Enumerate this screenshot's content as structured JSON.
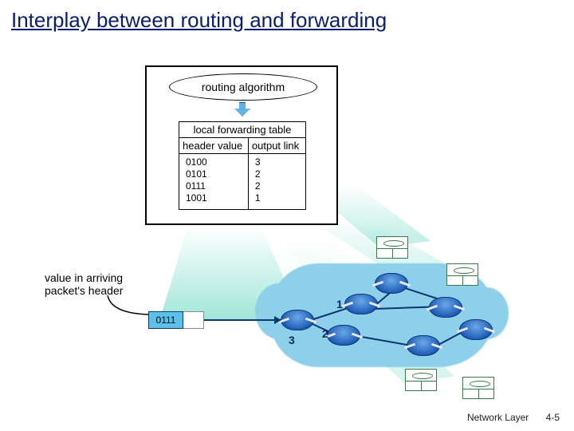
{
  "title": "Interplay between routing and forwarding",
  "routing_box": {
    "algorithm_label": "routing algorithm",
    "table_title": "local forwarding table",
    "col1": "header value",
    "col2": "output link",
    "rows": [
      {
        "header": "0100",
        "out": "3"
      },
      {
        "header": "0101",
        "out": "2"
      },
      {
        "header": "0111",
        "out": "2"
      },
      {
        "header": "1001",
        "out": "1"
      }
    ]
  },
  "annotation": "value in arriving packet's header",
  "packet_header": "0111",
  "ports": {
    "p1": "1",
    "p2": "2",
    "p3": "3"
  },
  "footer": {
    "chapter": "Network Layer",
    "page": "4-5"
  }
}
